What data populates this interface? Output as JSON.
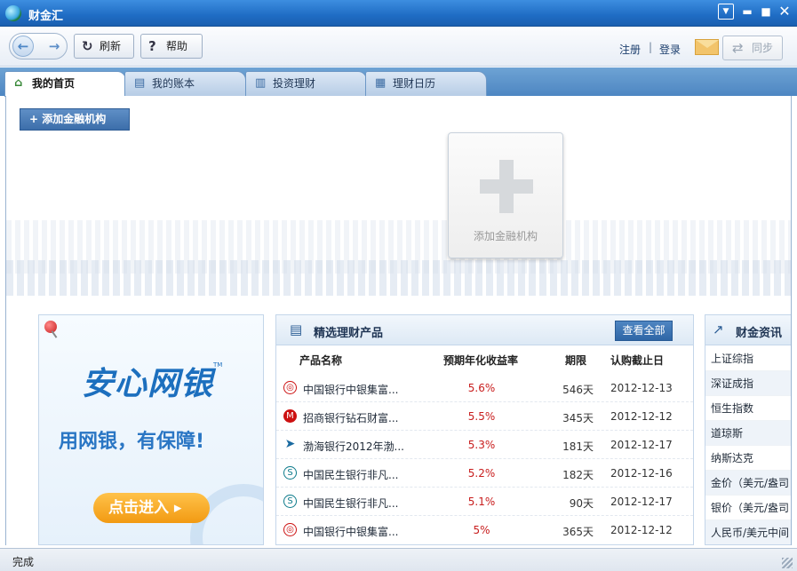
{
  "window": {
    "title": "财金汇"
  },
  "toolbar": {
    "back_glyph": "←",
    "forward_glyph": "→",
    "refresh_label": "刷新",
    "help_label": "帮助",
    "register_label": "注册",
    "separator": "|",
    "login_label": "登录",
    "sync_label": "同步"
  },
  "tabs": [
    {
      "label": "我的首页",
      "icon": "home-icon",
      "active": true
    },
    {
      "label": "我的账本",
      "icon": "ledger-icon",
      "active": false
    },
    {
      "label": "投资理财",
      "icon": "chart-icon",
      "active": false
    },
    {
      "label": "理财日历",
      "icon": "calendar-icon",
      "active": false
    }
  ],
  "home": {
    "add_institution_button": "+ 添加金融机构",
    "add_card_label": "添加金融机构"
  },
  "promo": {
    "brand": "安心网银",
    "tm": "TM",
    "slogan": "用网银，有保障!",
    "cta": "点击进入 ▸"
  },
  "products": {
    "title": "精选理财产品",
    "view_all": "查看全部",
    "columns": [
      "产品名称",
      "预期年化收益率",
      "期限",
      "认购截止日"
    ],
    "rows": [
      {
        "bank": "boc",
        "name": "中国银行中银集富...",
        "rate": "5.6%",
        "term": "546天",
        "deadline": "2012-12-13"
      },
      {
        "bank": "cmb",
        "name": "招商银行钻石财富...",
        "rate": "5.5%",
        "term": "345天",
        "deadline": "2012-12-12"
      },
      {
        "bank": "bohai",
        "name": "渤海银行2012年渤...",
        "rate": "5.3%",
        "term": "181天",
        "deadline": "2012-12-17"
      },
      {
        "bank": "cmbc",
        "name": "中国民生银行非凡...",
        "rate": "5.2%",
        "term": "182天",
        "deadline": "2012-12-16"
      },
      {
        "bank": "cmbc",
        "name": "中国民生银行非凡...",
        "rate": "5.1%",
        "term": "90天",
        "deadline": "2012-12-17"
      },
      {
        "bank": "boc",
        "name": "中国银行中银集富...",
        "rate": "5%",
        "term": "365天",
        "deadline": "2012-12-12"
      }
    ]
  },
  "news": {
    "title": "财金资讯",
    "items": [
      "上证综指",
      "深证成指",
      "恒生指数",
      "道琼斯",
      "纳斯达克",
      "金价（美元/盎司",
      "银价（美元/盎司",
      "人民币/美元中间"
    ]
  },
  "status": {
    "text": "完成"
  },
  "colors": {
    "titlebar": "#1f6cc4",
    "accent": "#3c6eaa",
    "rate": "#c81d1d",
    "cta": "#f29a12"
  }
}
